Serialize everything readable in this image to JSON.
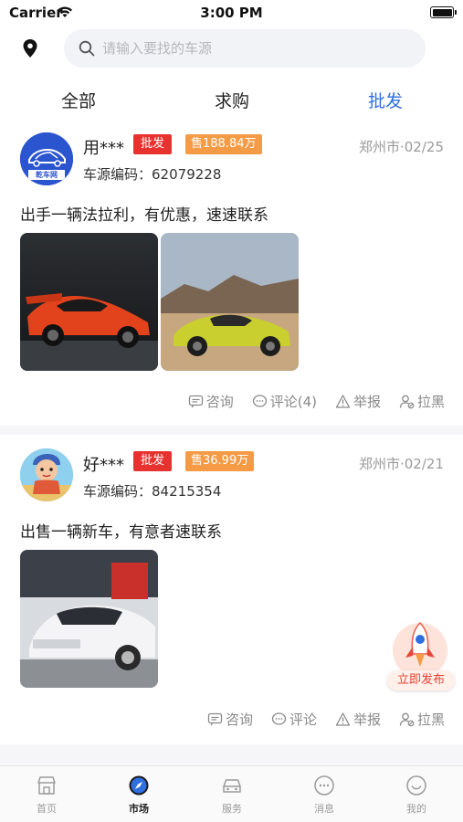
{
  "status_bar": {
    "carrier": "Carrier",
    "time": "3:00 PM"
  },
  "search": {
    "placeholder": "请输入要找的车源",
    "value": ""
  },
  "tabs": [
    {
      "label": "全部",
      "active": false
    },
    {
      "label": "求购",
      "active": false
    },
    {
      "label": "批发",
      "active": true
    }
  ],
  "posts": [
    {
      "username": "用***",
      "type_badge": "批发",
      "price_badge": "售188.84万",
      "location_date": "郑州市·02/25",
      "code_label": "车源编码：",
      "code": "62079228",
      "description": "出手一辆法拉利，有优惠，速速联系",
      "avatar_text": "乾车网",
      "actions": {
        "consult": "咨询",
        "comment": "评论(4)",
        "report": "举报",
        "block": "拉黑"
      }
    },
    {
      "username": "好***",
      "type_badge": "批发",
      "price_badge": "售36.99万",
      "location_date": "郑州市·02/21",
      "code_label": "车源编码：",
      "code": "84215354",
      "description": "出售一辆新车，有意者速联系",
      "actions": {
        "consult": "咨询",
        "comment": "评论",
        "report": "举报",
        "block": "拉黑"
      }
    }
  ],
  "publish_button": {
    "label": "立即发布"
  },
  "bottom_nav": [
    {
      "label": "首页",
      "icon": "shop-icon",
      "active": false
    },
    {
      "label": "市场",
      "icon": "compass-icon",
      "active": true
    },
    {
      "label": "服务",
      "icon": "car-icon",
      "active": false
    },
    {
      "label": "消息",
      "icon": "chat-icon",
      "active": false
    },
    {
      "label": "我的",
      "icon": "smile-icon",
      "active": false
    }
  ],
  "colors": {
    "accent": "#2f6fe0",
    "badge_red": "#e8322f",
    "badge_orange": "#f59b45",
    "muted": "#9a9a9a"
  }
}
